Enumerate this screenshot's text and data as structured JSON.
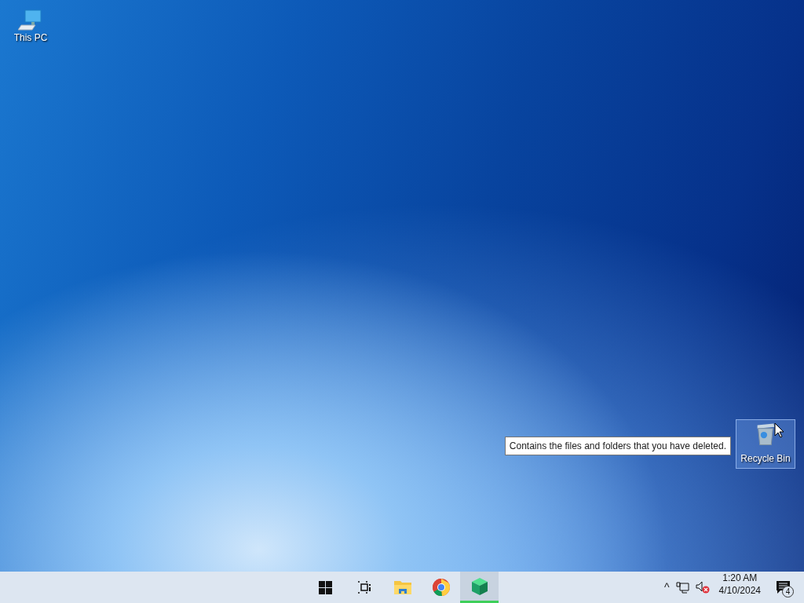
{
  "desktop_icons": [
    {
      "kind": "pc",
      "label": "This PC",
      "selected": false
    },
    {
      "kind": "recycle",
      "label": "Recycle Bin",
      "selected": true
    }
  ],
  "tooltip": {
    "text": "Contains the files and folders that you have deleted."
  },
  "taskbar": {
    "apps": [
      {
        "kind": "start",
        "active": false
      },
      {
        "kind": "taskview",
        "active": false
      },
      {
        "kind": "explorer",
        "active": false
      },
      {
        "kind": "browser",
        "active": false
      },
      {
        "kind": "cube",
        "active": true
      }
    ],
    "tray": {
      "show_hidden": "^",
      "volume_muted": true,
      "time": "1:20 AM",
      "date": "4/10/2024",
      "notifications": "4"
    }
  }
}
